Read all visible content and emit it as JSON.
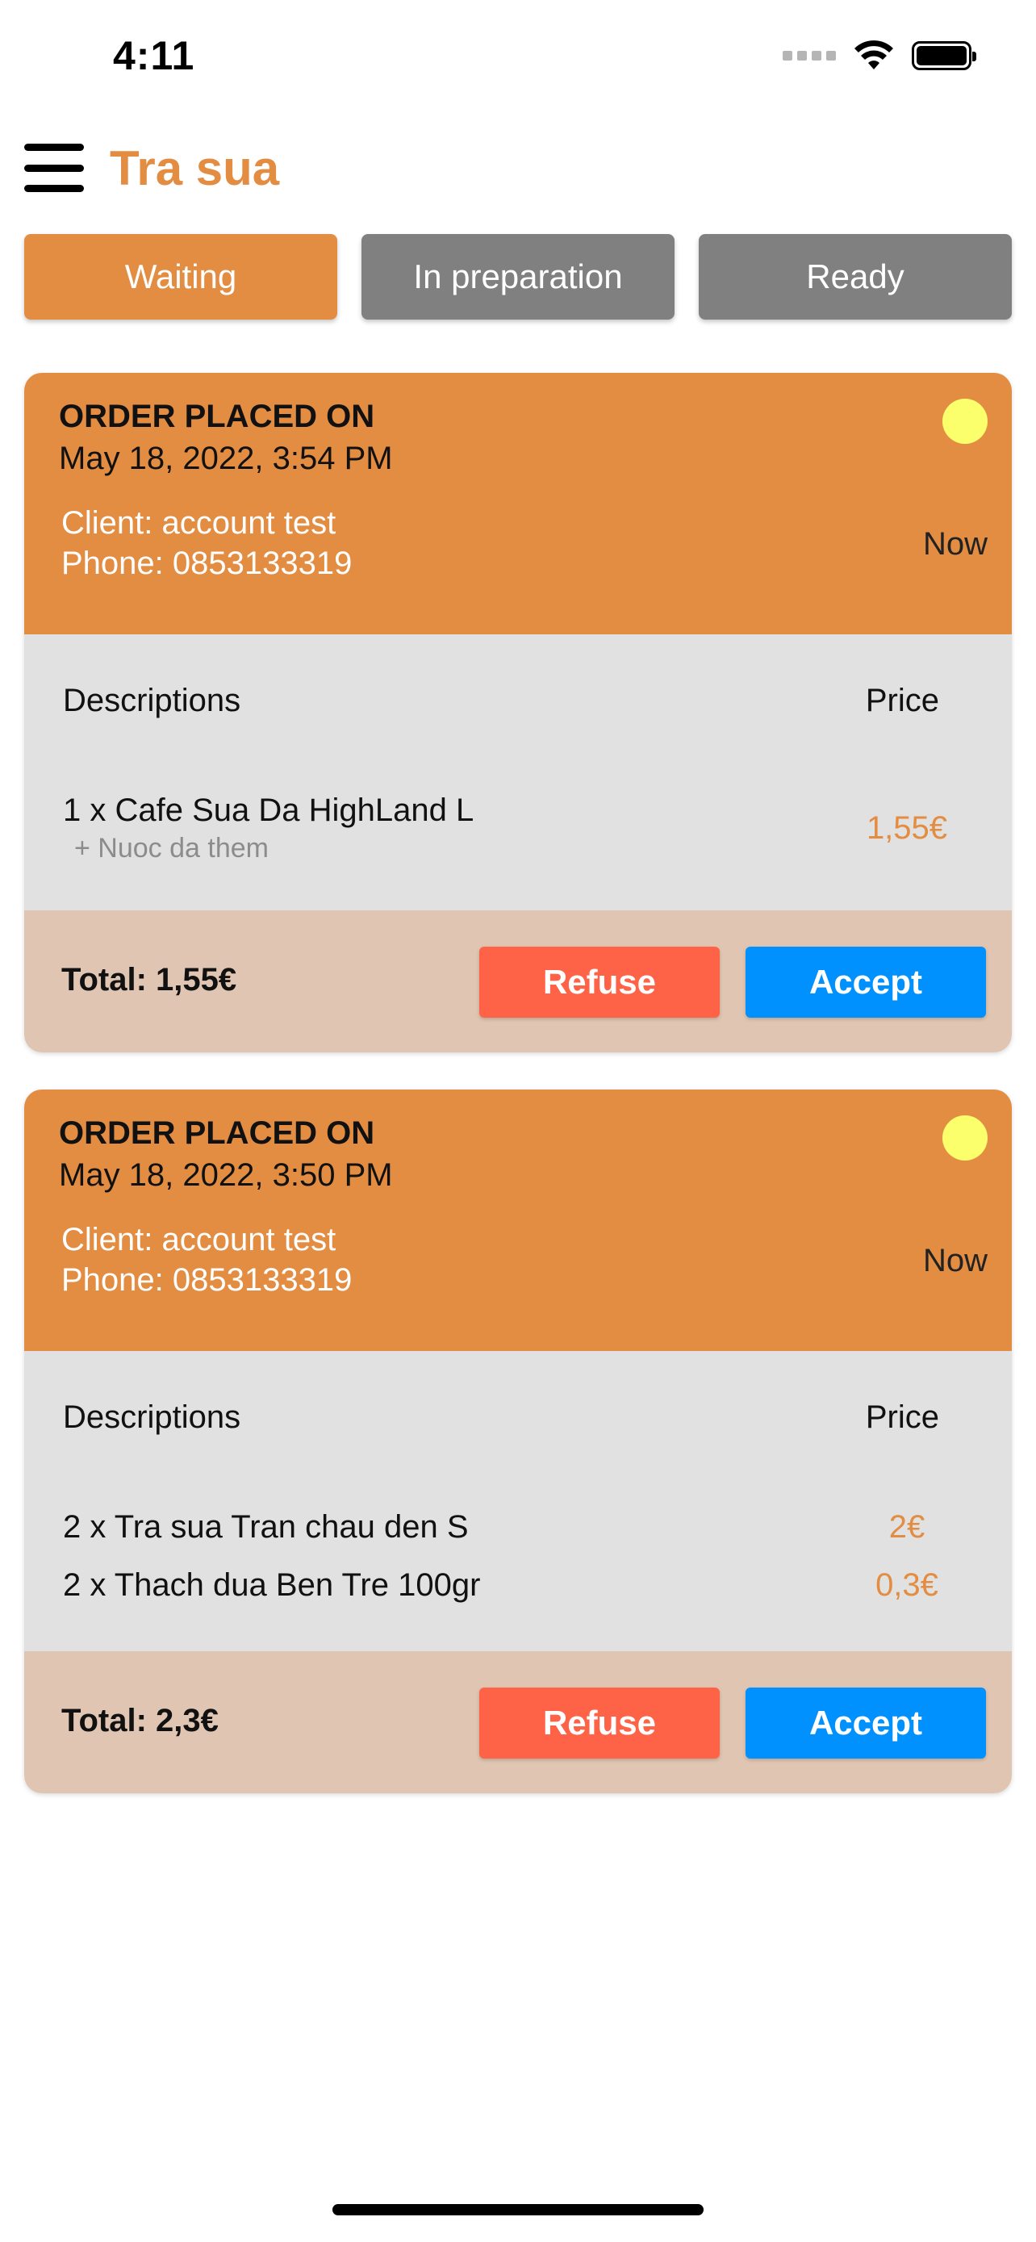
{
  "status_bar": {
    "time": "4:11"
  },
  "header": {
    "title": "Tra sua",
    "menu_icon": "hamburger-menu-icon"
  },
  "tabs": [
    {
      "label": "Waiting",
      "active": true
    },
    {
      "label": "In preparation",
      "active": false
    },
    {
      "label": "Ready",
      "active": false
    }
  ],
  "colors": {
    "accent": "#e38d43",
    "tab_inactive": "#808080",
    "refuse": "#ff6347",
    "accept": "#0091ff",
    "status_dot": "#fbff6b",
    "body_bg": "#e1e1e1",
    "footer_bg": "#e0c6b2"
  },
  "orders": [
    {
      "placed_label": "ORDER PLACED ON",
      "placed_date": "May 18, 2022, 3:54 PM",
      "client": "Client: account test",
      "phone": "Phone: 0853133319",
      "eta": "Now",
      "desc_header": "Descriptions",
      "price_header": "Price",
      "items": [
        {
          "name": "1 x Cafe Sua Da HighLand L",
          "sub": "+ Nuoc da them",
          "price": "1,55€"
        }
      ],
      "total": "Total: 1,55€",
      "refuse_label": "Refuse",
      "accept_label": "Accept"
    },
    {
      "placed_label": "ORDER PLACED ON",
      "placed_date": "May 18, 2022, 3:50 PM",
      "client": "Client: account test",
      "phone": "Phone: 0853133319",
      "eta": "Now",
      "desc_header": "Descriptions",
      "price_header": "Price",
      "items": [
        {
          "name": "2 x Tra sua Tran chau den S",
          "price": "2€"
        },
        {
          "name": "2 x Thach dua Ben Tre 100gr",
          "price": "0,3€"
        }
      ],
      "total": "Total: 2,3€",
      "refuse_label": "Refuse",
      "accept_label": "Accept"
    }
  ]
}
